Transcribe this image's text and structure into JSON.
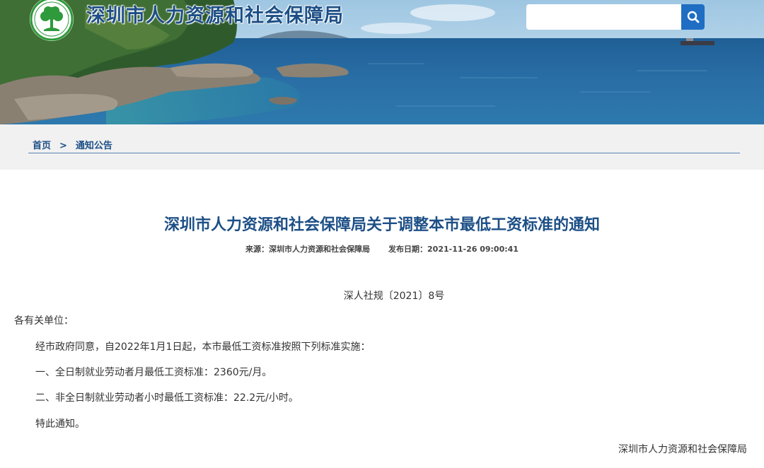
{
  "header": {
    "site_title": "深圳市人力资源和社会保障局",
    "search": {
      "placeholder": "",
      "value": ""
    },
    "search_icon": "magnifier-icon",
    "logo_icon": "tree-emblem-icon"
  },
  "breadcrumb": {
    "home": "首页",
    "separator": ">",
    "current": "通知公告"
  },
  "article": {
    "title": "深圳市人力资源和社会保障局关于调整本市最低工资标准的通知",
    "source_label": "来源：",
    "source": "深圳市人力资源和社会保障局",
    "date_label": "发布日期：",
    "date": "2021-11-26 09:00:41",
    "doc_number": "深人社规〔2021〕8号",
    "salutation": "各有关单位：",
    "paragraphs": [
      "经市政府同意，自2022年1月1日起，本市最低工资标准按照下列标准实施：",
      "一、全日制就业劳动者月最低工资标准：2360元/月。",
      "二、非全日制就业劳动者小时最低工资标准：22.2元/小时。",
      "特此通知。"
    ],
    "signature": "深圳市人力资源和社会保障局"
  },
  "colors": {
    "brand_blue": "#1d4f86",
    "search_button": "#1f6ec4",
    "breadcrumb_bg": "#f1f1f1",
    "logo_green": "#2e9a3c"
  }
}
